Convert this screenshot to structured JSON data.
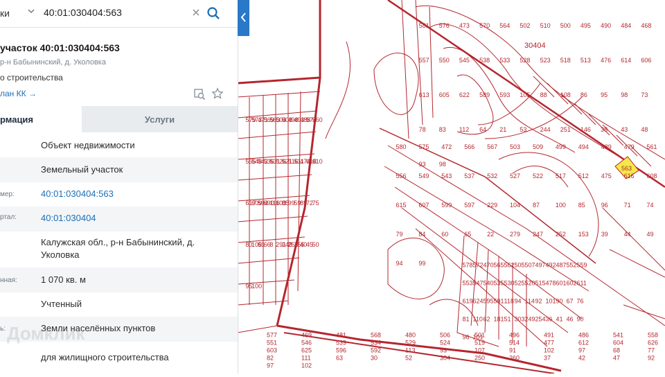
{
  "search": {
    "category": "ки",
    "value": "40:01:030404:563"
  },
  "card": {
    "title": "участок 40:01:030404:563",
    "subtitle": "р-н Бабынинский, д. Уколовка",
    "purpose": "о строительства",
    "plan_link": "лан КК →"
  },
  "tabs": {
    "info": "рмация",
    "services": "Услуги"
  },
  "rows": [
    {
      "label": "",
      "value": "Объект недвижимости"
    },
    {
      "label": "",
      "value": "Земельный участок"
    },
    {
      "label": "мер:",
      "value": "40:01:030404:563"
    },
    {
      "label": "ртал:",
      "value": "40:01:030404"
    },
    {
      "label": "",
      "value": "Калужская обл., р-н Бабынинский, д. Уколовка"
    },
    {
      "label": "нная:",
      "value": "1 070 кв. м"
    },
    {
      "label": "",
      "value": "Учтенный"
    },
    {
      "label": "ь:",
      "value": "Земли населённых пунктов"
    },
    {
      "label": "",
      "value": "для жилищного строительства"
    }
  ],
  "watermark": "Домклик",
  "map": {
    "quarter_label": "30404",
    "highlight_parcel": "563",
    "highlight_color": "#f5e84a",
    "line_color": "#b4262e",
    "labels": [
      "581",
      "580",
      "579",
      "578",
      "577",
      "576",
      "575",
      "573",
      "572",
      "469",
      "473",
      "472",
      "471",
      "470",
      "481",
      "570",
      "566",
      "569",
      "565",
      "568",
      "564",
      "567",
      "563",
      "562",
      "480",
      "502",
      "503",
      "504",
      "505",
      "506",
      "510",
      "509",
      "508",
      "507",
      "501",
      "500",
      "499",
      "498",
      "497",
      "496",
      "495",
      "494",
      "493",
      "492",
      "491",
      "490",
      "489",
      "488",
      "487",
      "486",
      "484",
      "479",
      "574",
      "552",
      "541",
      "468",
      "561",
      "560",
      "559",
      "558",
      "557",
      "556",
      "555",
      "553",
      "551",
      "550",
      "549",
      "548",
      "547",
      "546",
      "545",
      "543",
      "542",
      "540",
      "539",
      "538",
      "537",
      "536",
      "535",
      "534",
      "533",
      "532",
      "531",
      "530",
      "529",
      "528",
      "527",
      "526",
      "525",
      "524",
      "523",
      "522",
      "521",
      "520",
      "519",
      "518",
      "517",
      "516",
      "515",
      "514",
      "513",
      "512",
      "511",
      "478",
      "477",
      "476",
      "475",
      "474",
      "601",
      "612",
      "614",
      "616",
      "618",
      "602",
      "604",
      "606",
      "608",
      "610",
      "611",
      "626",
      "613",
      "615",
      "617",
      "619",
      "603",
      "605",
      "607",
      "609",
      "624",
      "625",
      "622",
      "599",
      "594",
      "595",
      "596",
      "589",
      "597",
      "590",
      "591",
      "592",
      "593",
      "229",
      "116",
      "118",
      "113",
      "105",
      "104",
      "103",
      "94",
      "93",
      "88",
      "87",
      "85",
      "114",
      "107",
      "108",
      "100",
      "99",
      "92",
      "91",
      "86",
      "85",
      "59",
      "101",
      "102",
      "95",
      "96",
      "89",
      "90",
      "97",
      "98",
      "71",
      "72",
      "67",
      "68",
      "73",
      "74",
      "75",
      "76",
      "77",
      "78",
      "79",
      "80",
      "81",
      "82",
      "83",
      "84",
      "109",
      "110",
      "111",
      "112",
      "60",
      "61",
      "62",
      "63",
      "64",
      "65",
      "66",
      "181",
      "30",
      "21",
      "22",
      "8",
      "51",
      "52",
      "53",
      "279",
      "291",
      "303",
      "304",
      "244",
      "247",
      "248",
      "249",
      "250",
      "251",
      "252",
      "253",
      "254",
      "260",
      "146",
      "153",
      "155",
      "36",
      "37",
      "38",
      "39",
      "40",
      "41",
      "42",
      "43",
      "44",
      "45",
      "46",
      "47",
      "48",
      "49",
      "50",
      "90",
      "92",
      "93",
      "94",
      "95",
      "96",
      "97",
      "98",
      "99",
      "100",
      "101",
      "102"
    ]
  }
}
